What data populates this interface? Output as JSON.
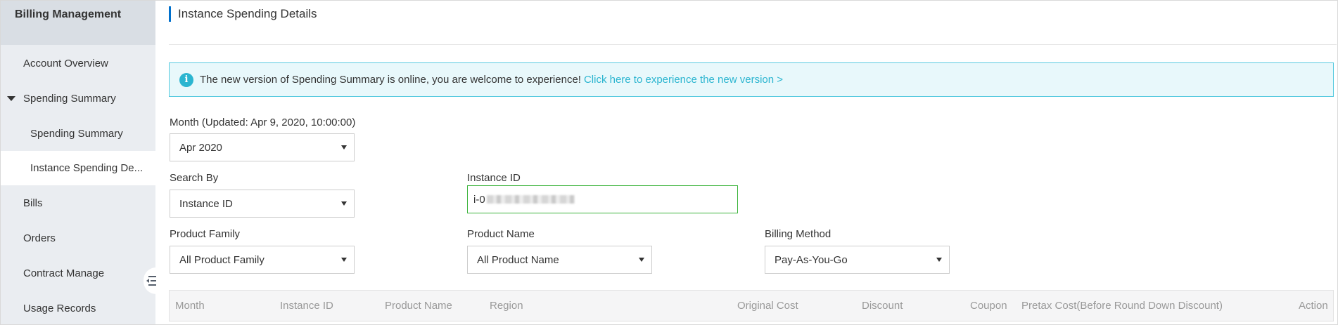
{
  "sidebar": {
    "title": "Billing Management",
    "items": [
      {
        "label": "Account Overview"
      },
      {
        "label": "Spending Summary"
      },
      {
        "label": "Spending Summary"
      },
      {
        "label": "Instance Spending De..."
      },
      {
        "label": "Bills"
      },
      {
        "label": "Orders"
      },
      {
        "label": "Contract Manage"
      },
      {
        "label": "Usage Records"
      }
    ]
  },
  "page": {
    "title": "Instance Spending Details"
  },
  "notice": {
    "icon": "i",
    "text": "The new version of Spending Summary is online, you are welcome to experience!",
    "link": "Click here to experience the new version >"
  },
  "filters": {
    "month": {
      "label": "Month (Updated: Apr 9, 2020, 10:00:00)",
      "value": "Apr 2020"
    },
    "search_by": {
      "label": "Search By",
      "value": "Instance ID"
    },
    "instance_id": {
      "label": "Instance ID",
      "value": "i-0"
    },
    "product_family": {
      "label": "Product Family",
      "value": "All Product Family"
    },
    "product_name": {
      "label": "Product Name",
      "value": "All Product Name"
    },
    "billing_method": {
      "label": "Billing Method",
      "value": "Pay-As-You-Go"
    }
  },
  "table": {
    "columns": [
      "Month",
      "Instance ID",
      "Product Name",
      "Region",
      "Original Cost",
      "Discount",
      "Coupon",
      "Pretax Cost(Before Round Down Discount)",
      "Action"
    ]
  },
  "colors": {
    "accent": "#0070cc",
    "info": "#2bb5d0",
    "input_focus": "#3bb33b"
  }
}
